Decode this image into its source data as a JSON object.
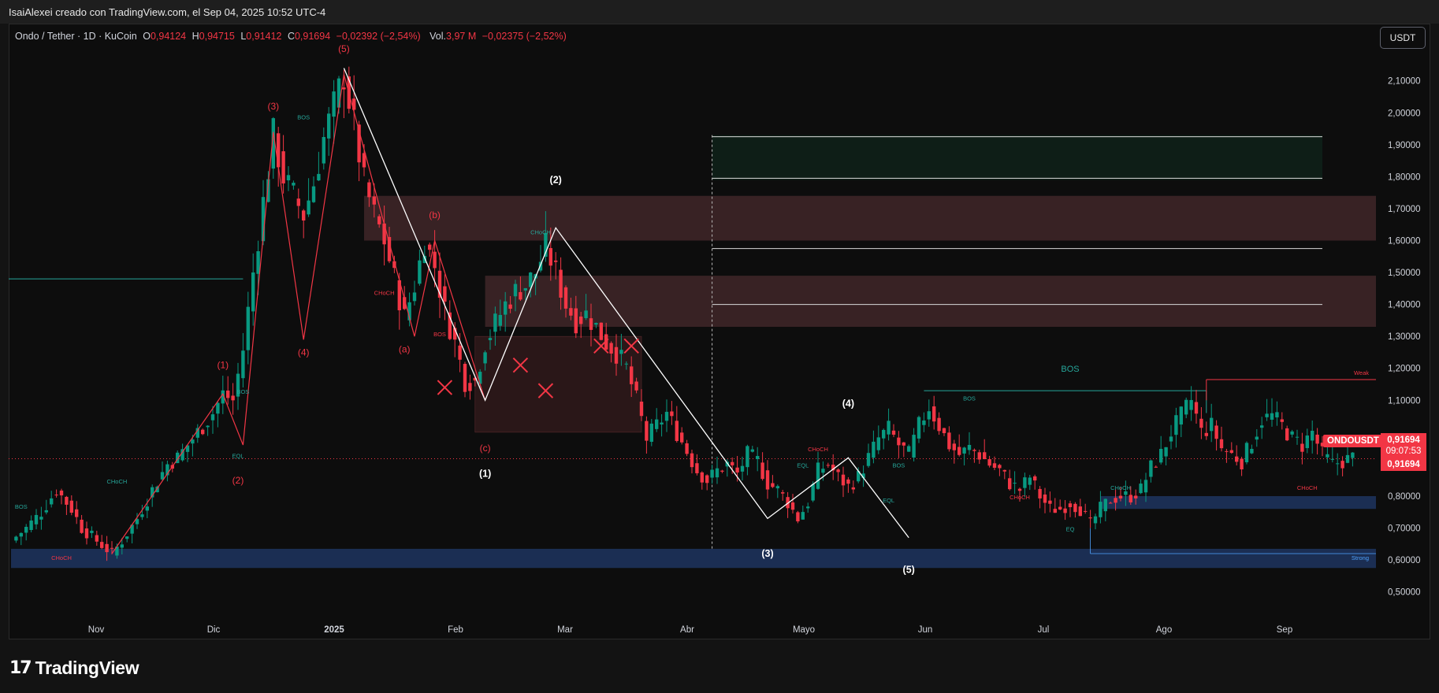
{
  "header": {
    "attribution": "IsaiAlexei creado con TradingView.com, el Sep 04, 2025 10:52 UTC-4"
  },
  "legend": {
    "symbol": "Ondo / Tether · 1D · KuCoin",
    "o_label": "O",
    "o": "0,94124",
    "h_label": "H",
    "h": "0,94715",
    "l_label": "L",
    "l": "0,91412",
    "c_label": "C",
    "c": "0,91694",
    "change": "−0,02392 (−2,54%)",
    "vol_label": "Vol.",
    "vol": "3,97 M",
    "vol_change": "−0,02375 (−2,52%)"
  },
  "currency_button": "USDT",
  "price_tag": {
    "symbol": "ONDOUSDT",
    "price": "0,91694",
    "countdown": "09:07:53",
    "price2": "0,91694"
  },
  "footer": {
    "brand": "TradingView",
    "logo_mark": "17"
  },
  "colors": {
    "background": "#0d0d0d",
    "up": "#089981",
    "down": "#f23645",
    "supply_zone": "#3b2426",
    "demand_zone": "#1c3057",
    "target_zone": "#0f2018",
    "wave_red": "#f23645",
    "wave_white": "#ffffff",
    "structure_teal": "#089981"
  },
  "chart_data": {
    "type": "candlestick",
    "title": "Ondo / Tether · 1D · KuCoin",
    "x_axis": {
      "ticks": [
        "Nov",
        "Dic",
        "2025",
        "Feb",
        "Mar",
        "Abr",
        "Mayo",
        "Jun",
        "Jul",
        "Ago",
        "Sep"
      ]
    },
    "y_axis": {
      "ticks": [
        "2,10000",
        "2,00000",
        "1,90000",
        "1,80000",
        "1,70000",
        "1,60000",
        "1,50000",
        "1,40000",
        "1,30000",
        "1,20000",
        "1,10000",
        "0,80000",
        "0,70000",
        "0,60000",
        "0,50000"
      ],
      "range": [
        0.45,
        2.17
      ]
    },
    "series": [
      {
        "name": "ONDOUSDT",
        "anchors_day_price": [
          [
            0,
            0.66
          ],
          [
            3,
            0.7
          ],
          [
            6,
            0.75
          ],
          [
            9,
            0.82
          ],
          [
            12,
            0.76
          ],
          [
            14,
            0.7
          ],
          [
            17,
            0.66
          ],
          [
            20,
            0.62
          ],
          [
            22,
            0.66
          ],
          [
            25,
            0.73
          ],
          [
            28,
            0.82
          ],
          [
            31,
            0.9
          ],
          [
            33,
            0.92
          ],
          [
            35,
            0.96
          ],
          [
            38,
            1.02
          ],
          [
            40,
            1.06
          ],
          [
            42,
            1.12
          ],
          [
            44,
            1.1
          ],
          [
            46,
            1.26
          ],
          [
            48,
            1.5
          ],
          [
            50,
            1.72
          ],
          [
            52,
            1.93
          ],
          [
            54,
            1.8
          ],
          [
            56,
            1.74
          ],
          [
            58,
            1.68
          ],
          [
            60,
            1.78
          ],
          [
            62,
            1.92
          ],
          [
            64,
            2.02
          ],
          [
            66,
            2.12
          ],
          [
            68,
            1.96
          ],
          [
            70,
            1.78
          ],
          [
            72,
            1.68
          ],
          [
            74,
            1.6
          ],
          [
            76,
            1.48
          ],
          [
            78,
            1.36
          ],
          [
            80,
            1.46
          ],
          [
            82,
            1.6
          ],
          [
            84,
            1.52
          ],
          [
            86,
            1.38
          ],
          [
            88,
            1.28
          ],
          [
            90,
            1.16
          ],
          [
            92,
            1.16
          ],
          [
            94,
            1.28
          ],
          [
            96,
            1.34
          ],
          [
            98,
            1.4
          ],
          [
            100,
            1.44
          ],
          [
            102,
            1.46
          ],
          [
            104,
            1.5
          ],
          [
            106,
            1.58
          ],
          [
            108,
            1.5
          ],
          [
            110,
            1.4
          ],
          [
            112,
            1.35
          ],
          [
            114,
            1.37
          ],
          [
            116,
            1.33
          ],
          [
            118,
            1.28
          ],
          [
            120,
            1.25
          ],
          [
            122,
            1.2
          ],
          [
            124,
            1.1
          ],
          [
            126,
            0.98
          ],
          [
            128,
            1.02
          ],
          [
            130,
            1.06
          ],
          [
            132,
            1.0
          ],
          [
            134,
            0.94
          ],
          [
            136,
            0.88
          ],
          [
            138,
            0.85
          ],
          [
            140,
            0.88
          ],
          [
            142,
            0.9
          ],
          [
            144,
            0.87
          ],
          [
            146,
            0.93
          ],
          [
            148,
            0.91
          ],
          [
            150,
            0.84
          ],
          [
            152,
            0.82
          ],
          [
            154,
            0.78
          ],
          [
            156,
            0.73
          ],
          [
            158,
            0.78
          ],
          [
            160,
            0.88
          ],
          [
            162,
            0.9
          ],
          [
            164,
            0.86
          ],
          [
            166,
            0.83
          ],
          [
            168,
            0.86
          ],
          [
            170,
            0.92
          ],
          [
            172,
            0.98
          ],
          [
            174,
            1.01
          ],
          [
            176,
            0.96
          ],
          [
            178,
            0.93
          ],
          [
            180,
            1.02
          ],
          [
            182,
            1.08
          ],
          [
            184,
            1.02
          ],
          [
            186,
            0.96
          ],
          [
            188,
            0.93
          ],
          [
            190,
            0.95
          ],
          [
            192,
            0.93
          ],
          [
            194,
            0.9
          ],
          [
            196,
            0.88
          ],
          [
            198,
            0.84
          ],
          [
            200,
            0.82
          ],
          [
            202,
            0.86
          ],
          [
            204,
            0.8
          ],
          [
            206,
            0.76
          ],
          [
            208,
            0.76
          ],
          [
            210,
            0.78
          ],
          [
            212,
            0.76
          ],
          [
            214,
            0.71
          ],
          [
            216,
            0.76
          ],
          [
            218,
            0.79
          ],
          [
            220,
            0.8
          ],
          [
            222,
            0.8
          ],
          [
            224,
            0.82
          ],
          [
            226,
            0.89
          ],
          [
            228,
            0.93
          ],
          [
            230,
            1.0
          ],
          [
            232,
            1.05
          ],
          [
            234,
            1.1
          ],
          [
            236,
            1.0
          ],
          [
            238,
            1.02
          ],
          [
            240,
            0.95
          ],
          [
            242,
            0.93
          ],
          [
            244,
            0.91
          ],
          [
            246,
            0.97
          ],
          [
            248,
            1.04
          ],
          [
            250,
            1.05
          ],
          [
            252,
            1.02
          ],
          [
            254,
            0.98
          ],
          [
            256,
            0.96
          ],
          [
            258,
            1.0
          ],
          [
            260,
            0.93
          ],
          [
            262,
            0.9
          ],
          [
            264,
            0.91
          ],
          [
            266,
            0.92
          ]
        ]
      }
    ],
    "zones": [
      {
        "name": "supply-upper",
        "y": [
          1.6,
          1.74
        ],
        "x_start_day": 70
      },
      {
        "name": "supply-lower",
        "y": [
          1.33,
          1.49
        ],
        "x_start_day": 94
      },
      {
        "name": "target-green",
        "y": [
          1.79,
          1.93
        ],
        "x_start_day": 139,
        "x_end_day": 260
      },
      {
        "name": "demand-upper",
        "y": [
          0.76,
          0.8
        ],
        "x_start_day": 216
      },
      {
        "name": "demand-lower",
        "y": [
          0.575,
          0.635
        ],
        "x_start_day": 0
      }
    ],
    "target_lines": [
      1.925,
      1.795,
      1.575,
      1.4
    ],
    "resistance_line": 1.48,
    "bos_line": 1.13,
    "weak_high": 1.165,
    "strong_low": 0.62,
    "current_price": 0.91694,
    "vertical_marker_day": 139,
    "wave_labels_red": [
      "(1)",
      "(2)",
      "(3)",
      "(4)",
      "(5)",
      "(a)",
      "(b)",
      "(c)"
    ],
    "wave_labels_white": [
      "(1)",
      "(2)",
      "(3)",
      "(4)",
      "(5)"
    ],
    "structure_labels": [
      "BOS",
      "CHoCH",
      "EQL",
      "EQ",
      "Weak",
      "Strong"
    ],
    "grid": false,
    "legend_position": "top-left"
  }
}
